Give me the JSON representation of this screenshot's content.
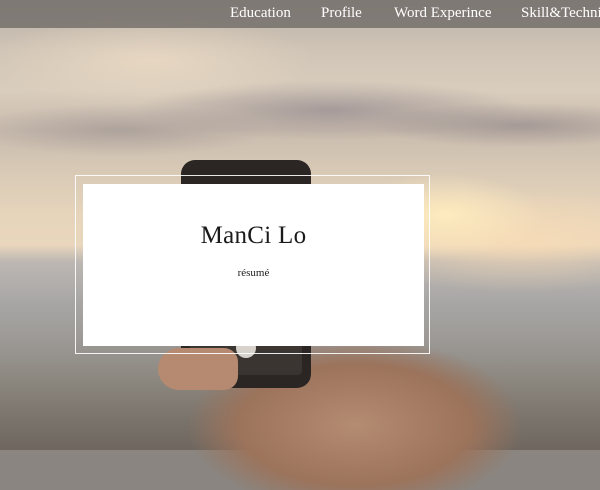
{
  "nav": {
    "items": [
      {
        "label": "Education"
      },
      {
        "label": "Profile"
      },
      {
        "label": "Word Experince"
      },
      {
        "label": "Skill&Techni"
      }
    ]
  },
  "hero": {
    "name": "ManCi Lo",
    "subtitle": "résumé"
  },
  "colors": {
    "nav_background": "#6e6966",
    "nav_text": "#ffffff",
    "card_background": "#ffffff",
    "card_frame": "#ffffff"
  }
}
